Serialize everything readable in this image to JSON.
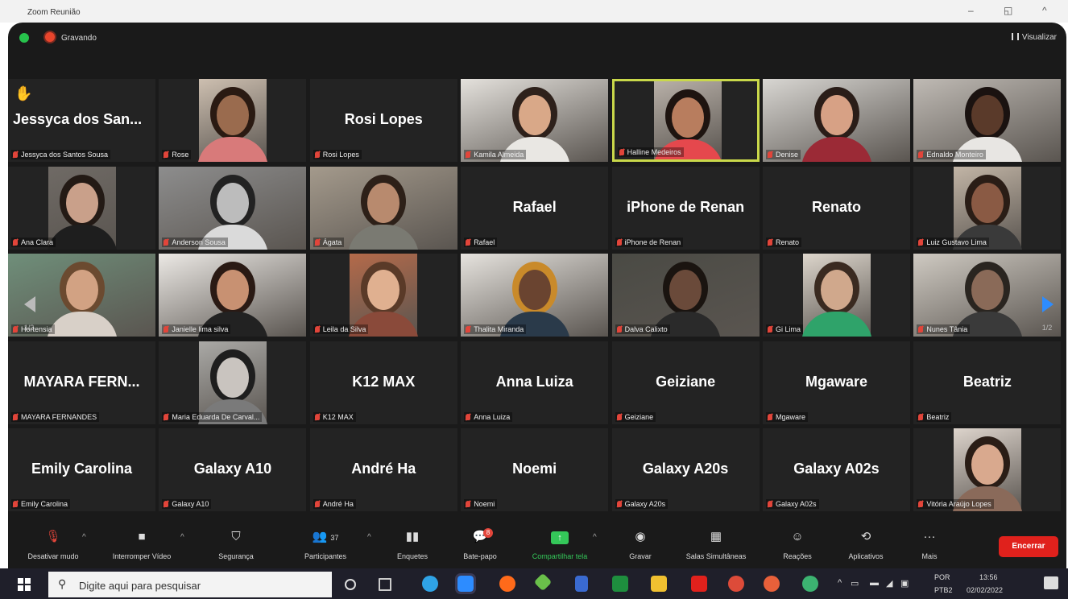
{
  "window": {
    "title": "Zoom Reunião",
    "minimize": "–",
    "restore": "◱",
    "expand": "^"
  },
  "topbar": {
    "recording": "Gravando",
    "view": "Visualizar"
  },
  "pager": {
    "page": "1/2"
  },
  "tiles": [
    {
      "label": "Jessyca dos Santos Sousa",
      "display": "Jessyca dos San...",
      "video": false,
      "hand": true
    },
    {
      "label": "Rose",
      "display": "",
      "video": true,
      "bg": "#cdbfb0",
      "skin": "#9a6b4e",
      "hair": "#2a1a12",
      "shirt": "#d87a7a"
    },
    {
      "label": "Rosi Lopes",
      "display": "Rosi Lopes",
      "video": false
    },
    {
      "label": "Kamila Almeida",
      "display": "",
      "video": true,
      "bg": "#e4e1dc",
      "skin": "#d9a888",
      "hair": "#2e211b",
      "shirt": "#e9e7e3"
    },
    {
      "label": "Halline Medeiros",
      "display": "",
      "video": true,
      "active": true,
      "bg": "#b8b0a8",
      "skin": "#b87d5e",
      "hair": "#1e1410",
      "shirt": "#e5484d"
    },
    {
      "label": "Denise",
      "display": "",
      "video": true,
      "bg": "#d8d6d2",
      "skin": "#d7a185",
      "hair": "#2a1d18",
      "shirt": "#9b2a36"
    },
    {
      "label": "Ednaldo Monteiro",
      "display": "",
      "video": true,
      "bg": "#bfbab4",
      "skin": "#5a3a2a",
      "hair": "#1a1210",
      "shirt": "#e8e6e3"
    },
    {
      "label": "Ana Clara",
      "display": "",
      "video": true,
      "bg": "#6f6a65",
      "skin": "#c9a08a",
      "hair": "#231a15",
      "shirt": "#1e1e1e"
    },
    {
      "label": "Anderson Sousa",
      "display": "",
      "video": true,
      "bg": "#8d8d8d",
      "skin": "#bcbcbc",
      "hair": "#222",
      "shirt": "#dadada"
    },
    {
      "label": "Ágata",
      "display": "",
      "video": true,
      "bg": "#a49a8c",
      "skin": "#b88a6e",
      "hair": "#2d2018",
      "shirt": "#7a7a72"
    },
    {
      "label": "Rafael",
      "display": "Rafael",
      "video": false
    },
    {
      "label": "iPhone de Renan",
      "display": "iPhone de Renan",
      "video": false
    },
    {
      "label": "Renato",
      "display": "Renato",
      "video": false
    },
    {
      "label": "Luiz Gustavo Lima",
      "display": "",
      "video": true,
      "bg": "#c2b5a6",
      "skin": "#8a5a44",
      "hair": "#2a1d16",
      "shirt": "#3a3a3a"
    },
    {
      "label": "Hortensia",
      "display": "",
      "video": true,
      "bg": "#6f8f7a",
      "skin": "#d2a283",
      "hair": "#6b4a30",
      "shirt": "#d8d0c8"
    },
    {
      "label": "Janielle lima silva",
      "display": "",
      "video": true,
      "bg": "#ece9e5",
      "skin": "#c89172",
      "hair": "#2a1a14",
      "shirt": "#222"
    },
    {
      "label": "Leila da Silva",
      "display": "",
      "video": true,
      "bg": "#b46a4a",
      "skin": "#e0b090",
      "hair": "#5a3a28",
      "shirt": "#8a4a3a"
    },
    {
      "label": "Thalita Miranda",
      "display": "",
      "video": true,
      "bg": "#e6e3de",
      "skin": "#6a4430",
      "hair": "#c98a2a",
      "shirt": "#2a3a4a"
    },
    {
      "label": "Dalva Calixto",
      "display": "",
      "video": true,
      "bg": "#4a4a44",
      "skin": "#6a4a3a",
      "hair": "#1a1410",
      "shirt": "#2a2a2a"
    },
    {
      "label": "Gi Lima",
      "display": "",
      "video": true,
      "bg": "#ddd6cc",
      "skin": "#d0a88c",
      "hair": "#3a2a20",
      "shirt": "#2fa36a"
    },
    {
      "label": "Nunes Tânia",
      "display": "",
      "video": true,
      "bg": "#cfcac2",
      "skin": "#8a6a58",
      "hair": "#2a2520",
      "shirt": "#3a3a3a"
    },
    {
      "label": "MAYARA FERNANDES",
      "display": "MAYARA FERN...",
      "video": false
    },
    {
      "label": "Maria Eduarda De Carval...",
      "display": "",
      "video": true,
      "bg": "#aaa9a6",
      "skin": "#c9c4bf",
      "hair": "#1e1e1e",
      "shirt": "#7a7a7a"
    },
    {
      "label": "K12 MAX",
      "display": "K12 MAX",
      "video": false
    },
    {
      "label": "Anna Luiza",
      "display": "Anna Luiza",
      "video": false
    },
    {
      "label": "Geiziane",
      "display": "Geiziane",
      "video": false
    },
    {
      "label": "Mgaware",
      "display": "Mgaware",
      "video": false
    },
    {
      "label": "Beatriz",
      "display": "Beatriz",
      "video": false
    },
    {
      "label": "Emily Carolina",
      "display": "Emily Carolina",
      "video": false
    },
    {
      "label": "Galaxy A10",
      "display": "Galaxy A10",
      "video": false
    },
    {
      "label": "André Ha",
      "display": "André Ha",
      "video": false
    },
    {
      "label": "Noemi",
      "display": "Noemi",
      "video": false
    },
    {
      "label": "Galaxy A20s",
      "display": "Galaxy A20s",
      "video": false
    },
    {
      "label": "Galaxy A02s",
      "display": "Galaxy A02s",
      "video": false
    },
    {
      "label": "Vitória Araújo Lopes",
      "display": "",
      "video": true,
      "bg": "#ddd4cc",
      "skin": "#d9a98e",
      "hair": "#2a1d16",
      "shirt": "#8a6a5a"
    }
  ],
  "toolbar": {
    "mute": "Desativar mudo",
    "video": "Interromper Vídeo",
    "security": "Segurança",
    "participants": "Participantes",
    "participants_count": "37",
    "polls": "Enquetes",
    "chat": "Bate-papo",
    "chat_badge": "8",
    "share": "Compartilhar tela",
    "record": "Gravar",
    "breakout": "Salas Simultâneas",
    "reactions": "Reações",
    "apps": "Aplicativos",
    "more": "Mais",
    "more_dots": "···",
    "end": "Encerrar"
  },
  "taskbar": {
    "search_placeholder": "Digite aqui para pesquisar",
    "lang": "POR",
    "layout": "PTB2",
    "time": "13:56",
    "date": "02/02/2022"
  }
}
